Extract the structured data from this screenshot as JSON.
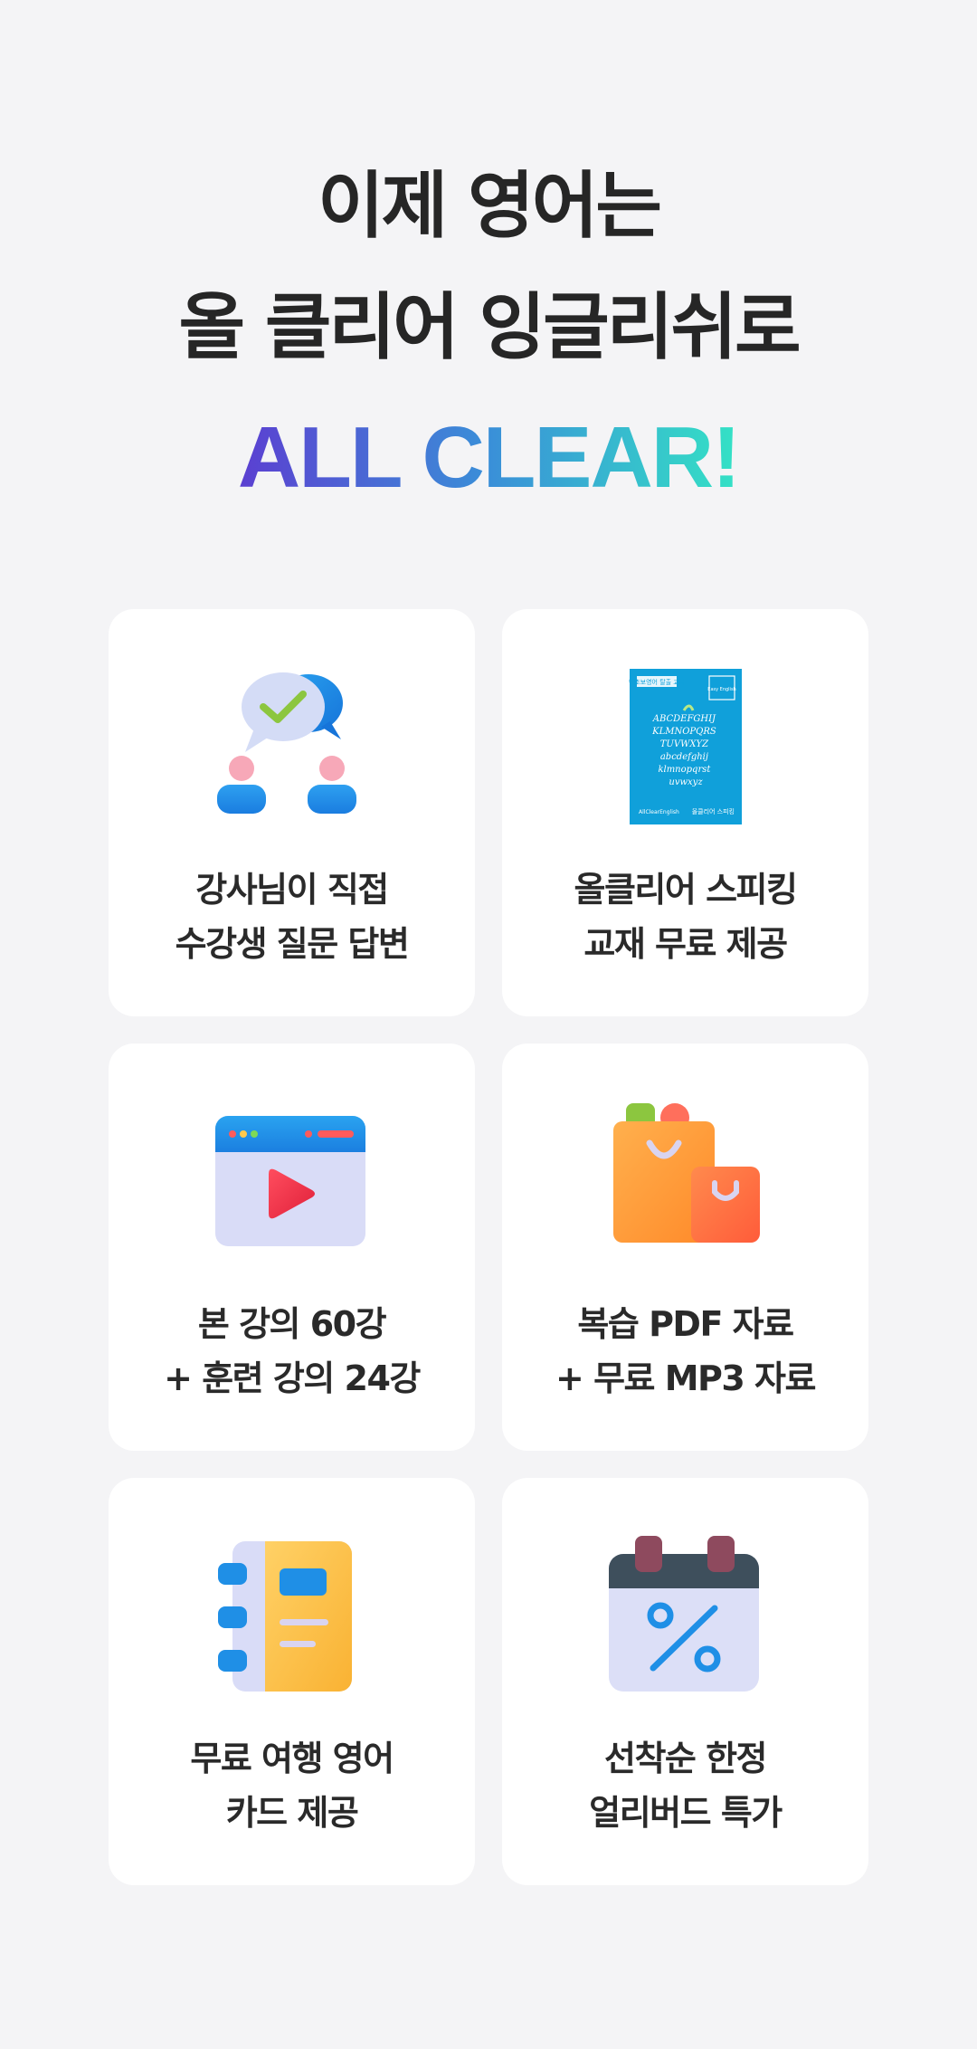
{
  "hero": {
    "line1": "이제 영어는",
    "line2": "올 클리어 잉글리쉬로",
    "accent": "ALL CLEAR!",
    "accent_gradient": [
      "#5b3fd1",
      "#3a8fd8",
      "#34e2c5"
    ]
  },
  "cards": [
    {
      "icon": "chat-check-icon",
      "line1": "강사님이 직접",
      "line2": "수강생 질문 답변"
    },
    {
      "icon": "textbook-cover-icon",
      "line1": "올클리어 스피킹",
      "line2": "교재 무료 제공",
      "book": {
        "badge": "왕초보영어 탈출 교재",
        "corner": "Easy English",
        "script": "ABCDEFGHIJ KLMNOPQRS TUVWXYZ abcdefghij klmnopqrst uvwxyz",
        "footer_left": "AllClearEnglish",
        "footer_right": "올클리어 스피킹"
      }
    },
    {
      "icon": "video-player-icon",
      "line1": "본 강의 60강",
      "line2": "+ 훈련 강의 24강"
    },
    {
      "icon": "shopping-bags-icon",
      "line1": "복습 PDF 자료",
      "line2": "+ 무료 MP3 자료"
    },
    {
      "icon": "notebook-icon",
      "line1": "무료 여행 영어",
      "line2": "카드 제공"
    },
    {
      "icon": "calendar-discount-icon",
      "line1": "선착순 한정",
      "line2": "얼리버드 특가"
    }
  ]
}
